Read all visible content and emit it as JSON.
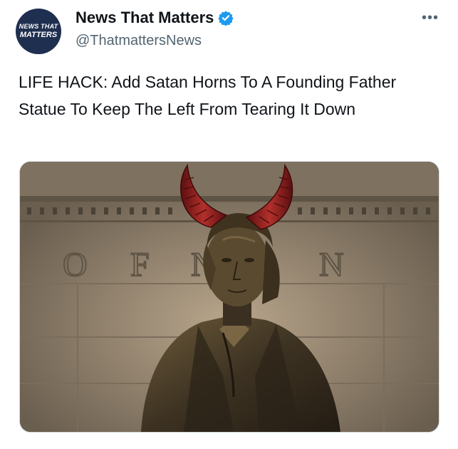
{
  "account": {
    "avatar_line1": "NEWS THAT",
    "avatar_line2": "MATTERS",
    "display_name": "News That Matters",
    "handle": "@ThatmattersNews",
    "verified_color": "#1d9bf0"
  },
  "menu": {
    "more_label": "•••"
  },
  "tweet": {
    "text": "LIFE HACK: Add Satan Horns To A Founding Father Statue To Keep The Left From Tearing It Down"
  },
  "media": {
    "wall_letters": [
      "O",
      "F",
      "N",
      "N"
    ]
  },
  "icons": {
    "verified": "verified-badge-icon",
    "more": "more-options-icon"
  }
}
